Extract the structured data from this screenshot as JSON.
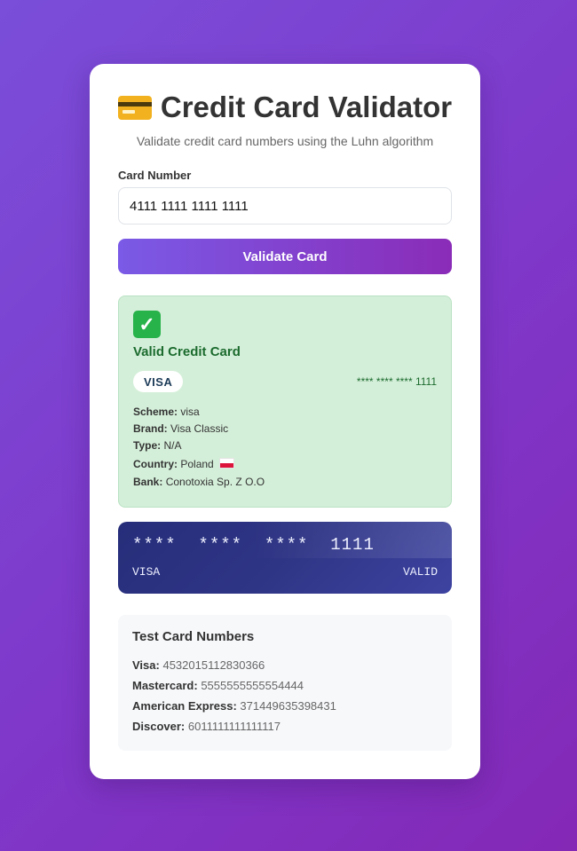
{
  "header": {
    "title": "Credit Card Validator",
    "subtitle": "Validate credit card numbers using the Luhn algorithm",
    "icon": "credit-card-icon"
  },
  "form": {
    "label": "Card Number",
    "value": "4111 1111 1111 1111",
    "button_label": "Validate Card"
  },
  "result": {
    "status_icon": "check-mark-icon",
    "status_color": "#27b24a",
    "title": "Valid Credit Card",
    "brand_badge": "VISA",
    "masked_number": "**** **** **** 1111",
    "details": {
      "scheme_label": "Scheme:",
      "scheme_value": "visa",
      "brand_label": "Brand:",
      "brand_value": "Visa Classic",
      "type_label": "Type:",
      "type_value": "N/A",
      "country_label": "Country:",
      "country_value": "Poland",
      "country_flag": "poland-flag-icon",
      "bank_label": "Bank:",
      "bank_value": "Conotoxia Sp. Z O.O"
    }
  },
  "visual_card": {
    "number": "****  ****  ****  1111",
    "brand": "VISA",
    "status": "VALID"
  },
  "test_cards": {
    "title": "Test Card Numbers",
    "items": [
      {
        "label": "Visa:",
        "number": "4532015112830366"
      },
      {
        "label": "Mastercard:",
        "number": "5555555555554444"
      },
      {
        "label": "American Express:",
        "number": "371449635398431"
      },
      {
        "label": "Discover:",
        "number": "6011111111111117"
      }
    ]
  }
}
